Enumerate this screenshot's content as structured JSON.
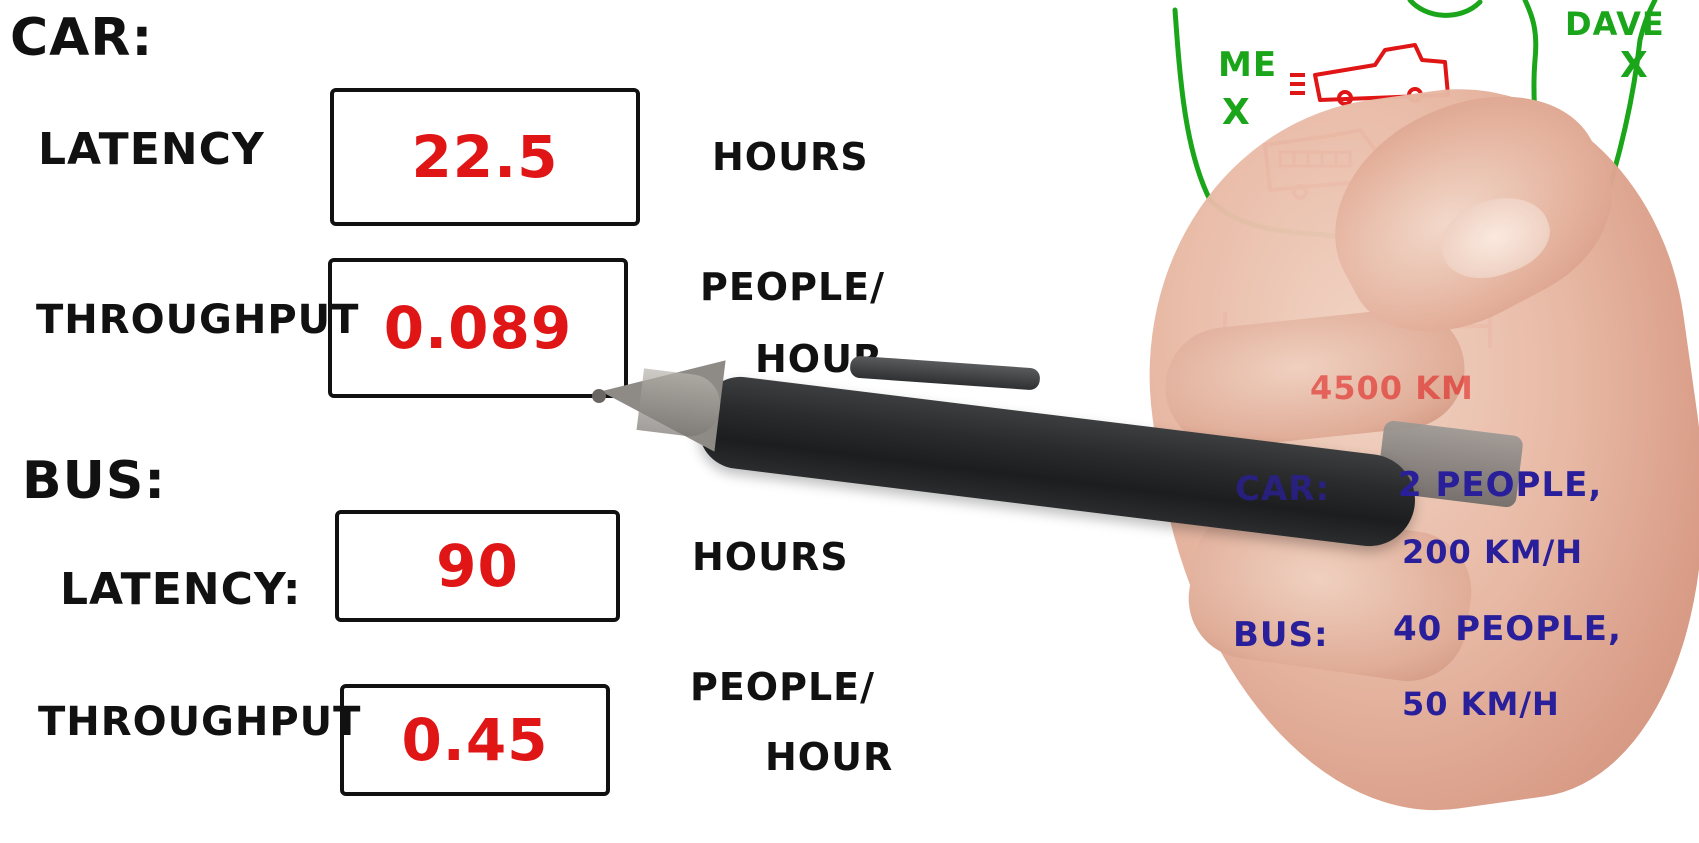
{
  "car_section": {
    "title": "CAR:",
    "latency_label": "LATENCY",
    "latency_value": "22.5",
    "latency_unit": "HOURS",
    "throughput_label": "THROUGHPUT",
    "throughput_value": "0.089",
    "throughput_unit_line1": "PEOPLE/",
    "throughput_unit_line2": "HOUR"
  },
  "bus_section": {
    "title": "BUS:",
    "latency_label": "LATENCY:",
    "latency_value": "90",
    "latency_unit": "HOURS",
    "throughput_label": "THROUGHPUT",
    "throughput_value": "0.45",
    "throughput_unit_line1": "PEOPLE/",
    "throughput_unit_line2": "HOUR"
  },
  "map_sketch": {
    "me_label": "ME",
    "me_marker": "X",
    "dave_label": "DAVE",
    "dave_marker": "X",
    "distance_label": "4500 KM"
  },
  "specs": {
    "car_label": "CAR:",
    "car_line1": "2 PEOPLE,",
    "car_line2": "200 KM/H",
    "bus_label": "BUS:",
    "bus_line1": "40 PEOPLE,",
    "bus_line2": "50 KM/H"
  },
  "colors": {
    "ink_black": "#111111",
    "ink_red": "#e01515",
    "ink_green": "#1aa51a",
    "ink_blue": "#2a1f9a"
  }
}
